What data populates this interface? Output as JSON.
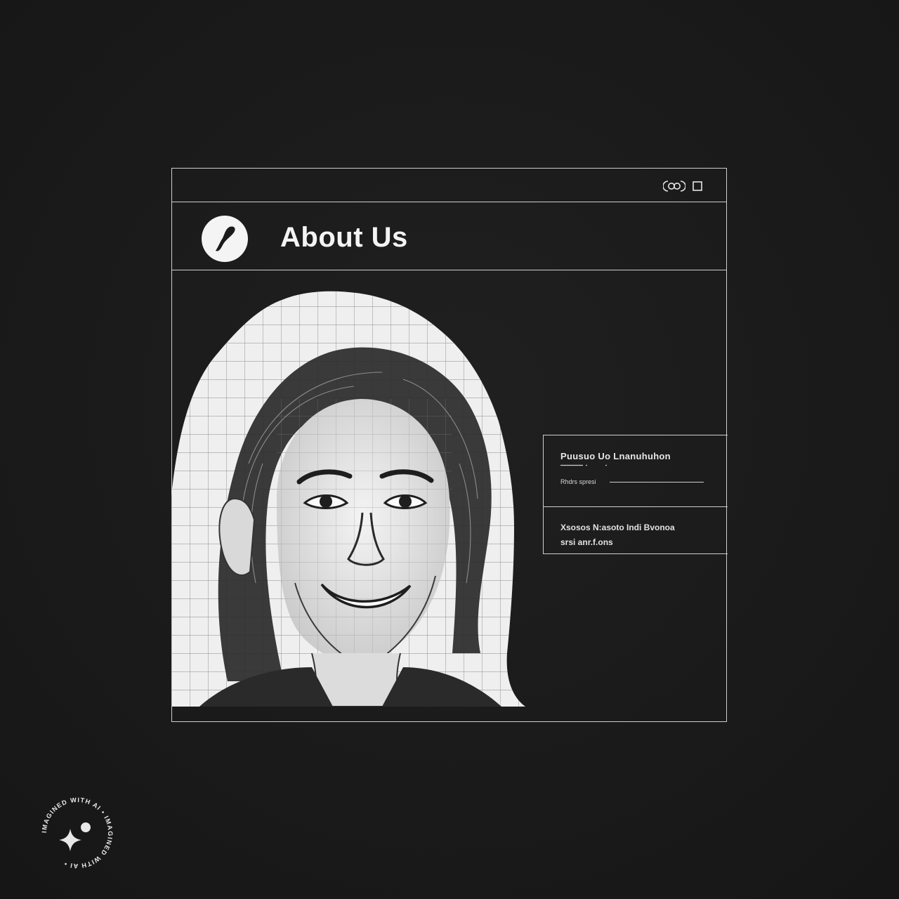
{
  "window": {
    "controls": [
      {
        "name": "link-icon",
        "glyph": "(⊗)"
      },
      {
        "name": "maximize-icon",
        "glyph": "□"
      }
    ]
  },
  "header": {
    "title": "About Us",
    "logo_icon": "brand-logo-icon"
  },
  "side_panel": {
    "heading": "Puusuo Uo Lnanuhuhon",
    "subline": "Rhdrs spresi",
    "body_line_1": "Xsosos N:asoto  Indi Bvonoa",
    "body_line_2": "srsi anr.f.ons"
  },
  "badge": {
    "text": "IMAGINED WITH AI • IMAGINED WITH AI •"
  },
  "colors": {
    "background": "#1b1b1b",
    "line": "#cfcfcf",
    "text": "#f2f2f2"
  }
}
